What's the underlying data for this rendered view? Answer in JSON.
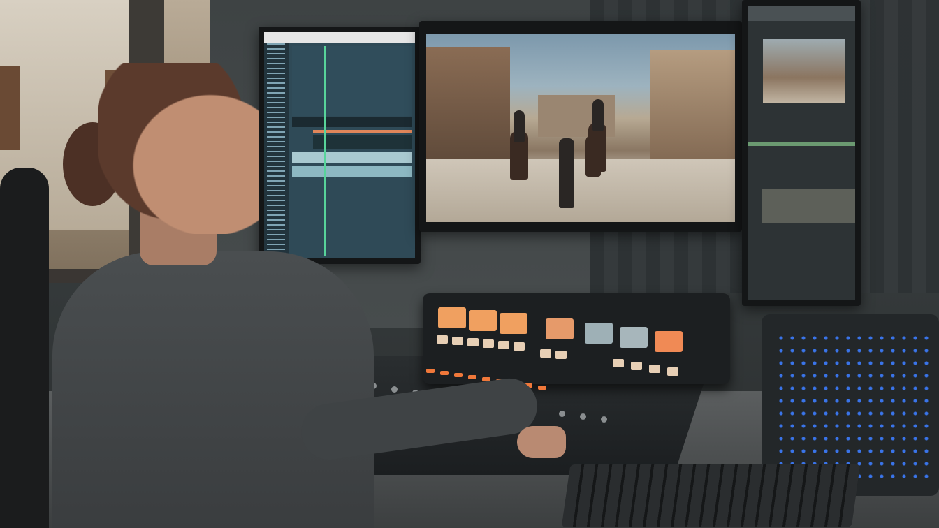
{
  "scene": {
    "description_free": true,
    "accent_colors": {
      "nle_background": "#2f4a57",
      "playhead": "#58d39a",
      "mixer_leds": "#f0783a",
      "control_blue": "#3c7dff"
    }
  },
  "left_monitor": {
    "app_title": ""
  }
}
